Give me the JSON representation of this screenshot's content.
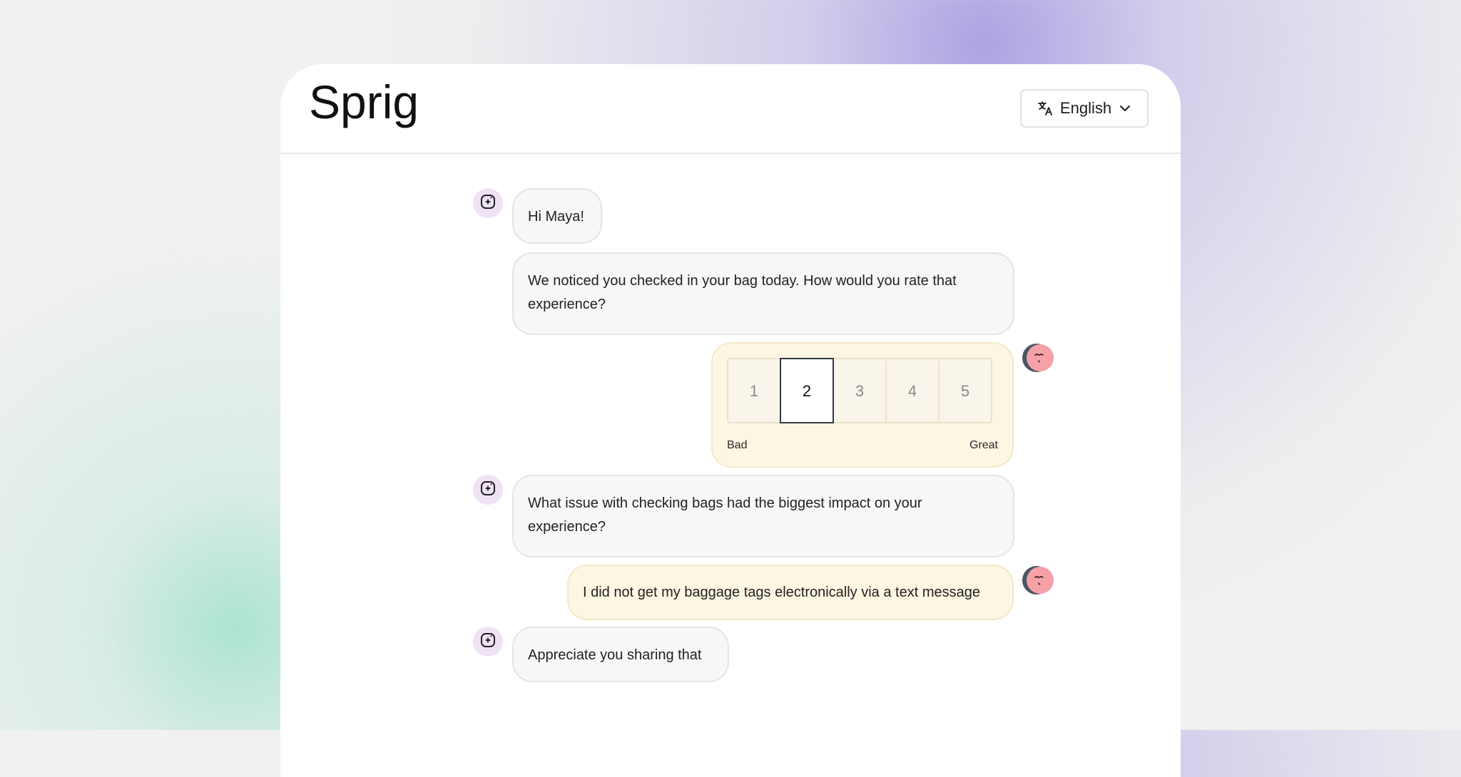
{
  "header": {
    "brand": "Sprig",
    "language_label": "English",
    "language_icon": "translate-icon",
    "dropdown_icon": "chevron-down-icon"
  },
  "chat": {
    "messages": [
      {
        "role": "bot",
        "text": "Hi Maya!"
      },
      {
        "role": "bot",
        "text": "We noticed you checked in your bag today. How would you rate that experience?"
      },
      {
        "role": "user",
        "type": "rating"
      },
      {
        "role": "bot",
        "text": "What issue with checking bags had the biggest impact on your experience?"
      },
      {
        "role": "user",
        "text": "I did not get my baggage tags electronically via a text message"
      },
      {
        "role": "bot",
        "text": "Appreciate you sharing that"
      }
    ],
    "rating": {
      "options": [
        "1",
        "2",
        "3",
        "4",
        "5"
      ],
      "selected": "2",
      "min_label": "Bad",
      "max_label": "Great"
    }
  },
  "colors": {
    "bot_bubble": "#f7f7f7",
    "user_bubble": "#fdf6e2",
    "bot_avatar": "#efe2f6",
    "user_avatar": "#f6a0a8"
  }
}
